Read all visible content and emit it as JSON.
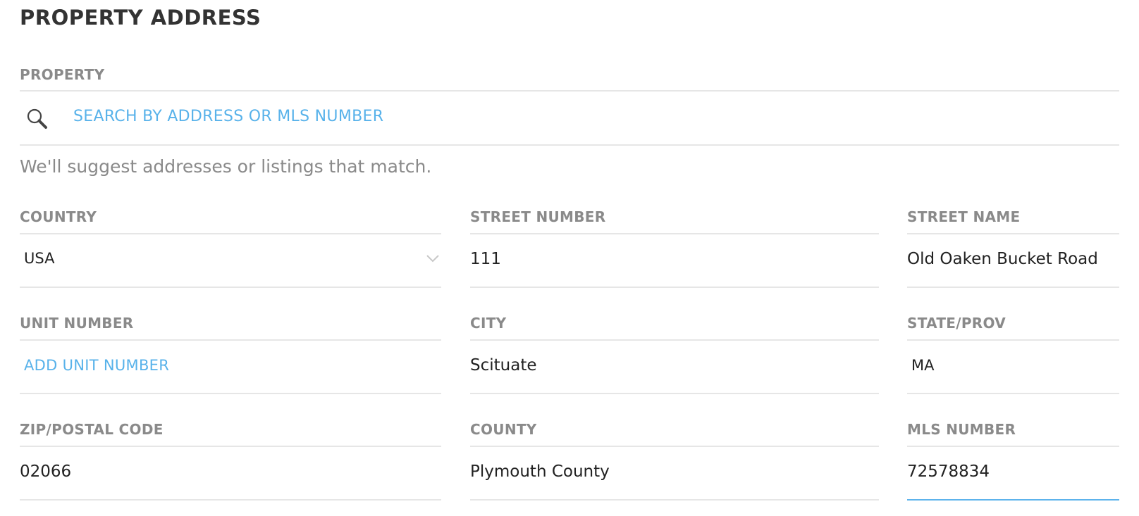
{
  "section": {
    "title": "PROPERTY ADDRESS"
  },
  "property": {
    "label": "PROPERTY",
    "search_placeholder": "SEARCH BY ADDRESS OR MLS NUMBER",
    "hint": "We'll suggest addresses or listings that match."
  },
  "fields": {
    "country": {
      "label": "COUNTRY",
      "value": "USA"
    },
    "street_number": {
      "label": "STREET NUMBER",
      "value": "111"
    },
    "street_name": {
      "label": "STREET NAME",
      "value": "Old Oaken Bucket Road"
    },
    "unit_number": {
      "label": "UNIT NUMBER",
      "action": "ADD UNIT NUMBER"
    },
    "city": {
      "label": "CITY",
      "value": "Scituate"
    },
    "state": {
      "label": "STATE/PROV",
      "value": "MA"
    },
    "zip": {
      "label": "ZIP/POSTAL CODE",
      "value": "02066"
    },
    "county": {
      "label": "COUNTY",
      "value": "Plymouth County"
    },
    "mls_number": {
      "label": "MLS NUMBER",
      "value": "72578834"
    }
  },
  "icons": {
    "search": "search-icon",
    "dropdown": "chevron-down-icon"
  },
  "colors": {
    "link": "#58b2ea",
    "active_underline": "#5db3ec",
    "label": "#8a8a8a"
  }
}
